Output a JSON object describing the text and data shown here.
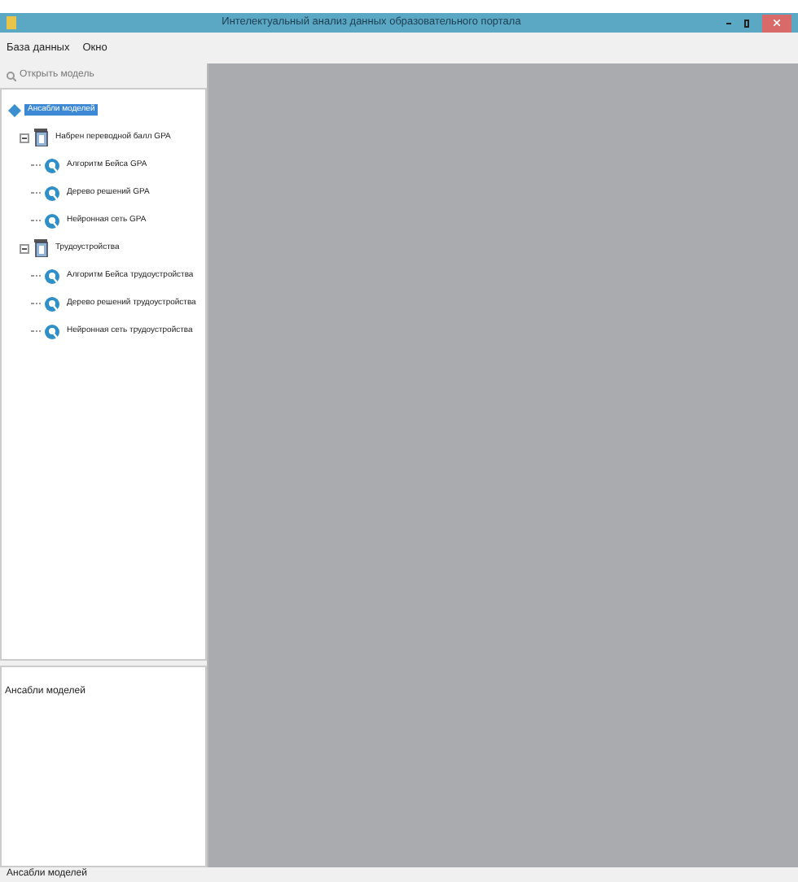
{
  "window": {
    "title": "Интелектуальный анализ данных образовательного портала"
  },
  "menu": [
    "База данных",
    "Окно"
  ],
  "toolbar": {
    "open_button": "Открыть модель"
  },
  "tree": [
    {
      "label": "Ансабли моделей",
      "selected": true,
      "kind": "root",
      "children": [
        {
          "label": "Набрен переводной балл GPA",
          "selected": false,
          "kind": "group",
          "expanded": true,
          "children": [
            {
              "label": "Алгоритм Бейса GPA",
              "selected": false,
              "kind": "model"
            },
            {
              "label": "Дерево решений GPA",
              "selected": false,
              "kind": "model"
            },
            {
              "label": "Нейронная сеть GPA",
              "selected": false,
              "kind": "model"
            }
          ]
        },
        {
          "label": "Трудоустройства",
          "selected": false,
          "kind": "group",
          "expanded": true,
          "children": [
            {
              "label": "Алгоритм Бейса трудоустройства",
              "selected": false,
              "kind": "model"
            },
            {
              "label": "Дерево решений трудоустройства",
              "selected": false,
              "kind": "model"
            },
            {
              "label": "Нейронная сеть трудоустройства",
              "selected": false,
              "kind": "model"
            }
          ]
        }
      ]
    }
  ],
  "details": {
    "text": "Ансабли моделей"
  },
  "status_bar": "Ансабли моделей"
}
